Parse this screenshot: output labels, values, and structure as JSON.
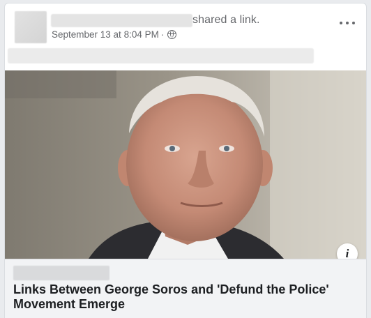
{
  "post": {
    "action_text": "shared a link.",
    "timestamp": "September 13 at 8:04 PM",
    "separator": "·",
    "audience_icon": "globe-icon",
    "more_icon": "more-options-icon"
  },
  "link_preview": {
    "headline": "Links Between George Soros and 'Defund the Police' Movement Emerge",
    "info_icon": "info-icon",
    "info_label": "i"
  },
  "colors": {
    "secondary_text": "#65676b",
    "primary_text": "#1c1e21",
    "footer_bg": "#f2f3f5"
  }
}
